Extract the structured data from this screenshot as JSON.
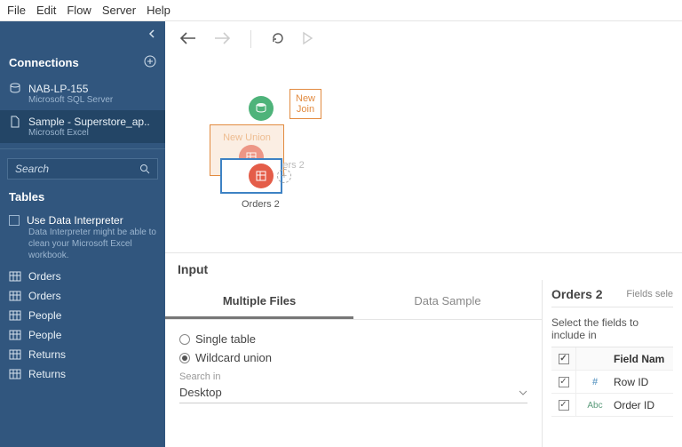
{
  "menu": [
    "File",
    "Edit",
    "Flow",
    "Server",
    "Help"
  ],
  "sidebar": {
    "connections_label": "Connections",
    "items": [
      {
        "name": "NAB-LP-155",
        "sub": "Microsoft SQL Server"
      },
      {
        "name": "Sample - Superstore_ap..",
        "sub": "Microsoft Excel"
      }
    ],
    "search_placeholder": "Search",
    "tables_label": "Tables",
    "interpreter": {
      "title": "Use Data Interpreter",
      "hint": "Data Interpreter might be able to clean your Microsoft Excel workbook."
    },
    "tables": [
      "Orders",
      "Orders",
      "People",
      "People",
      "Returns",
      "Returns"
    ]
  },
  "canvas": {
    "new_join": "New\nJoin",
    "new_union": "New Union",
    "orders2_top": "Orders 2",
    "orders2_bottom": "Orders 2"
  },
  "input": {
    "header": "Input",
    "tabs": [
      "Multiple Files",
      "Data Sample"
    ],
    "radios": [
      "Single table",
      "Wildcard union"
    ],
    "search_in_label": "Search in",
    "search_in_value": "Desktop"
  },
  "right": {
    "title": "Orders 2",
    "link": "Fields sele",
    "desc": "Select the fields to include in",
    "col_name": "Field Nam",
    "rows": [
      {
        "type": "#",
        "name": "Row ID"
      },
      {
        "type": "Abc",
        "name": "Order ID"
      }
    ]
  }
}
